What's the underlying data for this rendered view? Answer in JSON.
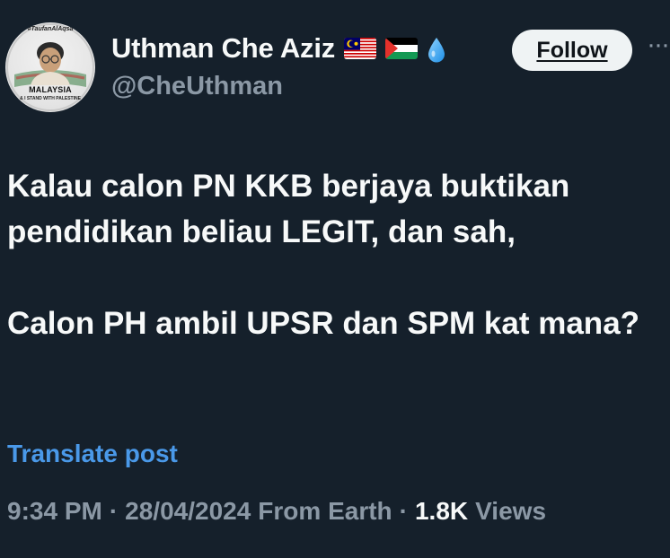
{
  "author": {
    "display_name": "Uthman Che Aziz",
    "handle": "@CheUthman",
    "badges": [
      "malaysia-flag-icon",
      "palestine-flag-icon",
      "water-drop-icon"
    ],
    "avatar": {
      "tag_text": "#TaufanAlAqsa",
      "country_text": "MALAYSIA",
      "sub_text": "& I STAND WITH PALESTINE"
    }
  },
  "actions": {
    "follow_label": "Follow",
    "more_label": "···"
  },
  "post": {
    "paragraphs": [
      "Kalau calon PN KKB berjaya buktikan pendidikan beliau LEGIT, dan sah,",
      "Calon PH ambil UPSR dan SPM kat mana?"
    ],
    "translate_label": "Translate post"
  },
  "meta": {
    "time": "9:34 PM",
    "separator": "·",
    "date": "28/04/2024",
    "location": "From Earth",
    "views_count": "1.8K",
    "views_label": "Views"
  },
  "colors": {
    "background": "#15202b",
    "primary_text": "#f7f9f9",
    "secondary_text": "#8b98a5",
    "link": "#4a99e9",
    "follow_bg": "#eff3f4"
  }
}
